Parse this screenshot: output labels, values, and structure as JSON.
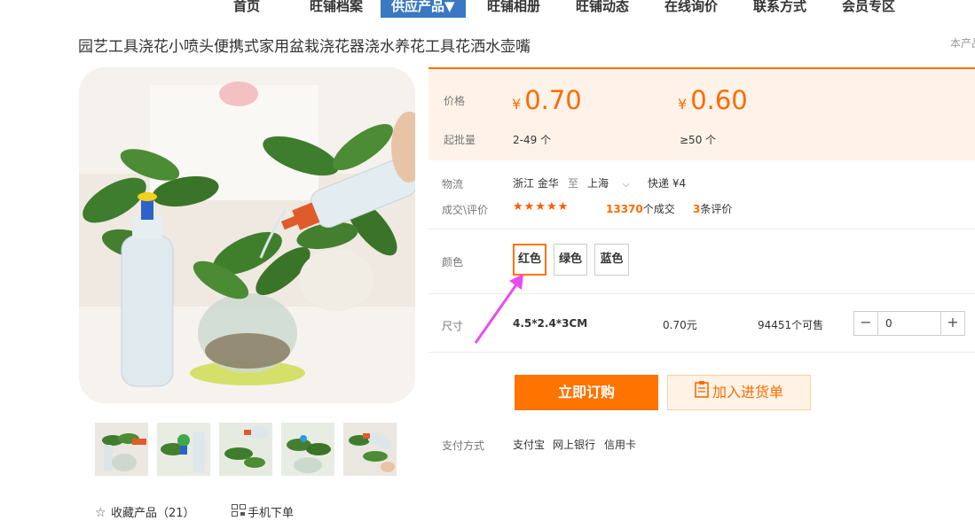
{
  "nav": {
    "items": [
      "首页",
      "旺铺档案",
      "供应产品▼",
      "旺铺相册",
      "旺铺动态",
      "在线询价",
      "联系方式",
      "会员专区"
    ]
  },
  "product": {
    "title": "园艺工具浇花小喷头便携式家用盆栽浇花器浇水养花工具花洒水壶嘴",
    "corner_text": "本产品"
  },
  "price": {
    "label": "价格",
    "currency": "¥",
    "tier1": "0.70",
    "tier2": "0.60",
    "moq_label": "起批量",
    "moq1": "2-49 个",
    "moq2": "≥50 个"
  },
  "logistics": {
    "label": "物流",
    "from": "浙江 金华",
    "to_word": "至",
    "destination": "上海",
    "shipping": "快递 ¥4"
  },
  "reviews": {
    "label": "成交\\评价",
    "stars": "★★★★★",
    "deals_count": "13370",
    "deals_suffix": "个成交",
    "review_count": "3",
    "review_suffix": "条评价"
  },
  "color": {
    "label": "颜色",
    "options": [
      "红色",
      "绿色",
      "蓝色"
    ],
    "selected": "红色"
  },
  "size": {
    "label": "尺寸",
    "value": "4.5*2.4*3CM",
    "price": "0.70元",
    "stock": "94451个可售",
    "quantity": "0"
  },
  "actions": {
    "buy": "立即订购",
    "add_cart": "加入进货单"
  },
  "payment": {
    "label": "支付方式",
    "methods": [
      "支付宝",
      "网上银行",
      "信用卡"
    ]
  },
  "footer": {
    "favorite": "收藏产品（21）",
    "mobile": "手机下单"
  },
  "colors": {
    "accent": "#ff7300",
    "price": "#ff6a00",
    "nav_active": "#3b78c3",
    "annotation_arrow": "#e84cf0"
  },
  "icons": [
    "down-arrow-icon",
    "star-icon",
    "qr-code-icon",
    "clipboard-icon",
    "minus-icon",
    "plus-icon"
  ]
}
